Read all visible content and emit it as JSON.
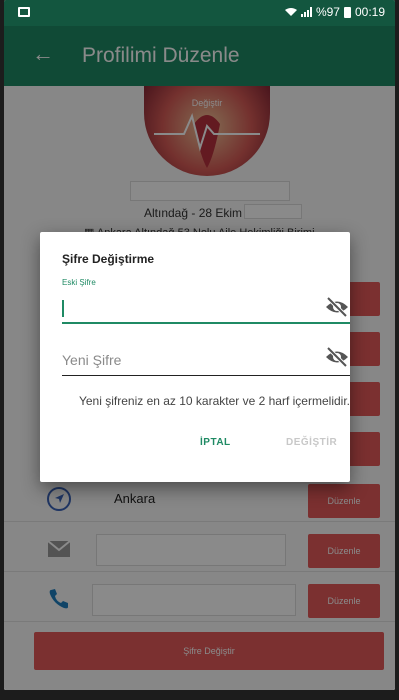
{
  "status_bar": {
    "signal_text": "%97",
    "time": "00:19"
  },
  "app_bar": {
    "title": "Profilimi Düzenle"
  },
  "profile": {
    "photo_label": "Değiştir",
    "district": "Altındağ - 28 Ekim",
    "address": "Ankara Altındağ 53 Nolu Aile Hekimliği Birimi"
  },
  "rows": [
    {
      "icon": "navigation-icon",
      "text": "Ankara",
      "button": "Düzenle"
    },
    {
      "icon": "mail-icon",
      "text": "",
      "button": "Düzenle"
    },
    {
      "icon": "phone-icon",
      "text": "",
      "button": "Düzenle"
    }
  ],
  "change_password_button": "Şifre Değiştir",
  "dialog": {
    "title": "Şifre Değiştirme",
    "old_password_label": "Eski Şifre",
    "new_password_placeholder": "Yeni Şifre",
    "hint": "Yeni şifreniz en az 10 karakter ve 2 harf içermelidir.",
    "cancel_label": "İPTAL",
    "confirm_label": "DEĞİŞTİR"
  },
  "colors": {
    "primary": "#1f8a64",
    "primary_dark": "#13563f",
    "accent_red": "#e45a5a",
    "disabled": "#c8c8c8"
  }
}
